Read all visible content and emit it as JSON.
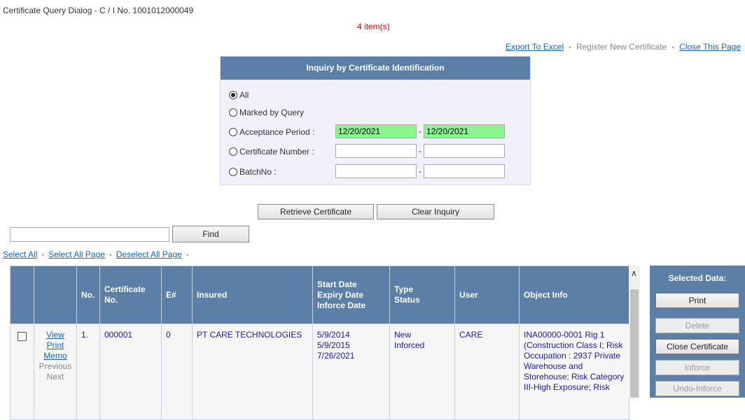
{
  "title": "Certificate Query Dialog - C / I No. 1001012000049",
  "item_count": "4 item(s)",
  "top_links": {
    "export": "Export To Excel",
    "register": "Register New Certificate",
    "close": "Close This Page"
  },
  "inquiry": {
    "header": "Inquiry by Certificate Identification",
    "options": {
      "all": "All",
      "marked": "Marked by Query",
      "acceptance": "Acceptance Period :",
      "cert_number": "Certificate Number :",
      "batch": "BatchNo :"
    },
    "selected": "All",
    "acceptance_from": "12/20/2021",
    "acceptance_to": "12/20/2021",
    "cert_from": "",
    "cert_to": "",
    "batch_from": "",
    "batch_to": "",
    "dash": "-"
  },
  "buttons": {
    "retrieve": "Retrieve Certificate",
    "clear": "Clear Inquiry",
    "find": "Find"
  },
  "find_value": "",
  "selection_links": {
    "select_all": "Select All",
    "select_all_page": "Select All Page",
    "deselect_all_page": "Deselect All Page"
  },
  "table": {
    "headers": {
      "no": "No.",
      "cert_no": "Certificate No.",
      "e": "E#",
      "insured": "Insured",
      "dates": [
        "Start Date",
        "Expiry Date",
        "Inforce Date"
      ],
      "type_status": [
        "Type",
        "Status"
      ],
      "user": "User",
      "object": "Object Info"
    },
    "rows": [
      {
        "actions": {
          "view": "View",
          "print": "Print",
          "memo": "Memo",
          "previous": "Previous",
          "next": "Next"
        },
        "no": "1.",
        "cert_no": "000001",
        "e": "0",
        "insured": "PT CARE TECHNOLOGIES",
        "start": "5/9/2014",
        "expiry": "5/9/2015",
        "inforce": "7/26/2021",
        "type": "New",
        "status": "Inforced",
        "user": "CARE",
        "object": "INA00000-0001 Rig 1 (Construction Class I; Risk Occupation : 2937 Private Warehouse and Storehouse; Risk Category III-High Exposure; Risk"
      }
    ]
  },
  "side_panel": {
    "header": "Selected Data:",
    "print": "Print",
    "delete": "Delete",
    "close_cert": "Close Certificate",
    "inforce": "Inforce",
    "undo_inforce": "Undo-Inforce"
  },
  "colors": {
    "header_blue": "#5b7fa6",
    "link_blue": "#1565c0",
    "date_green": "#8df58d",
    "count_red": "#e00000"
  }
}
